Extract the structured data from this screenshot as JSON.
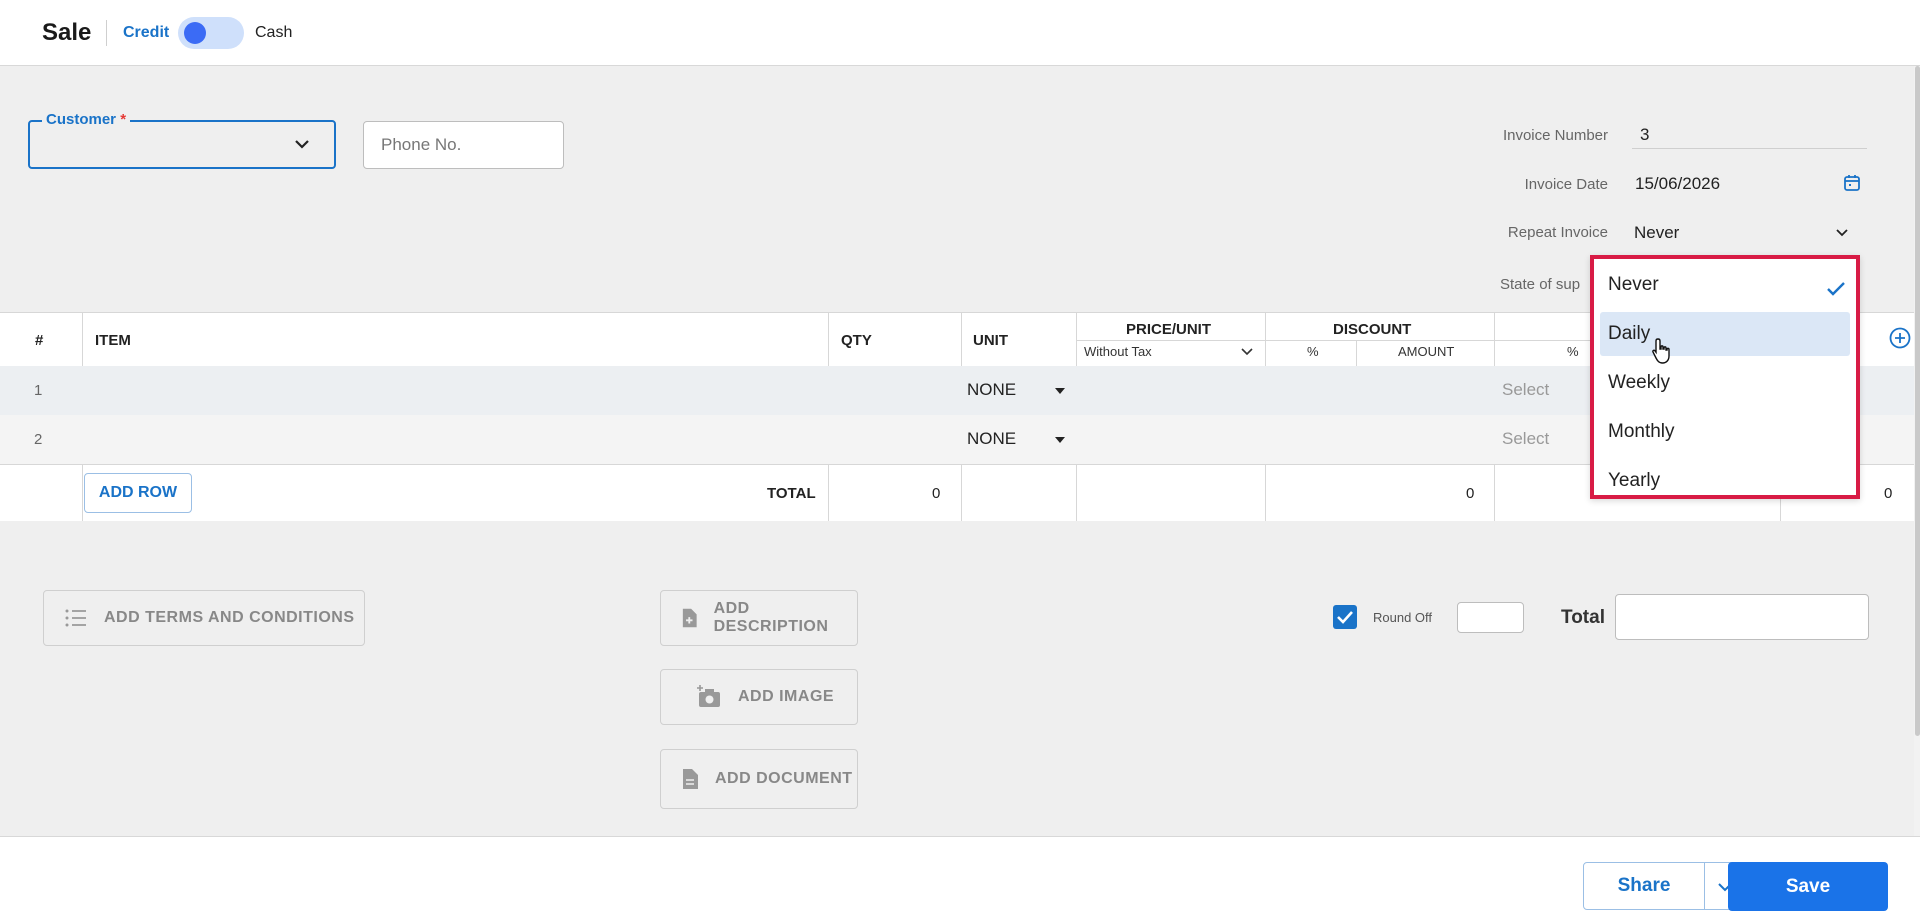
{
  "header": {
    "title": "Sale",
    "credit_label": "Credit",
    "cash_label": "Cash"
  },
  "customer": {
    "label": "Customer",
    "required_mark": "*"
  },
  "phone": {
    "placeholder": "Phone No."
  },
  "invoice": {
    "number_label": "Invoice Number",
    "number_value": "3",
    "date_label": "Invoice Date",
    "date_value": "15/06/2026",
    "repeat_label": "Repeat Invoice",
    "repeat_value": "Never",
    "state_label": "State of sup"
  },
  "table": {
    "headers": {
      "num": "#",
      "item": "ITEM",
      "qty": "QTY",
      "unit": "UNIT",
      "price": "PRICE/UNIT",
      "price_sub": "Without Tax",
      "discount": "DISCOUNT",
      "disc_pct": "%",
      "disc_amount": "AMOUNT",
      "tax_pct": "%"
    },
    "rows": [
      {
        "num": "1",
        "unit": "NONE",
        "tax": "Select"
      },
      {
        "num": "2",
        "unit": "NONE",
        "tax": "Select"
      }
    ],
    "add_row_label": "ADD ROW",
    "total_label": "TOTAL",
    "total_qty": "0",
    "total_discount": "0",
    "total_amount": "0"
  },
  "actions": {
    "terms_label": "ADD TERMS AND CONDITIONS",
    "description_label": "ADD DESCRIPTION",
    "image_label": "ADD IMAGE",
    "document_label": "ADD DOCUMENT"
  },
  "totals": {
    "round_off_label": "Round Off",
    "total_label": "Total"
  },
  "footer": {
    "share_label": "Share",
    "save_label": "Save"
  },
  "repeat_dropdown": {
    "options": [
      "Never",
      "Daily",
      "Weekly",
      "Monthly",
      "Yearly"
    ],
    "selected": "Never",
    "hovered": "Daily"
  },
  "colors": {
    "accent": "#1a73c8",
    "primary_button": "#1a73e8",
    "highlight_border": "#d81b45",
    "hover_bg": "#dbe7f6"
  }
}
